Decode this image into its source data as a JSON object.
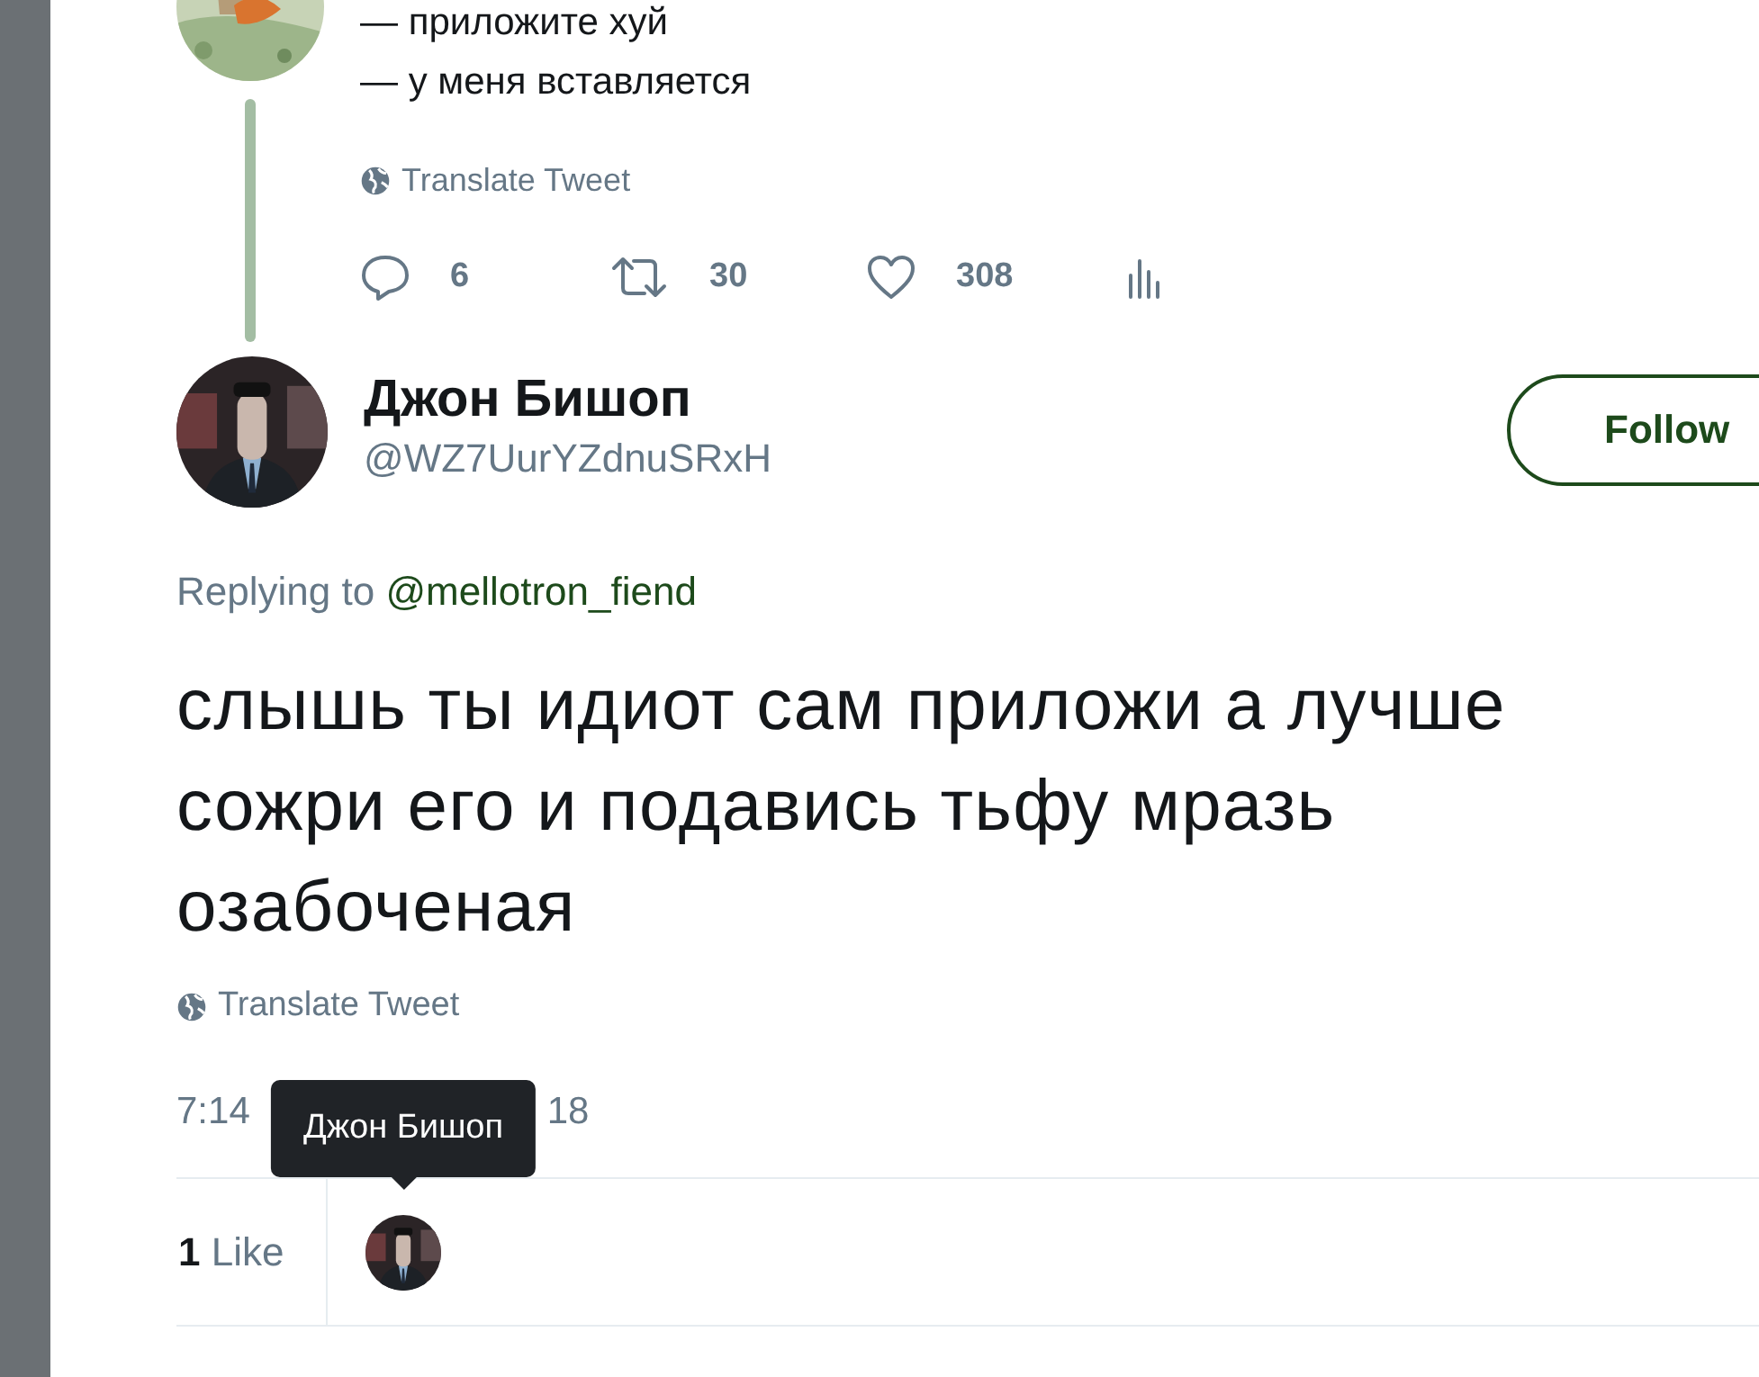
{
  "thread_tweet": {
    "lines": [
      "— приложите хуй",
      "— у меня вставляется"
    ],
    "translate": "Translate Tweet",
    "actions": [
      {
        "kind": "reply",
        "count": "6"
      },
      {
        "kind": "retweet",
        "count": "30"
      },
      {
        "kind": "like",
        "count": "308"
      },
      {
        "kind": "analytics"
      }
    ]
  },
  "tweet": {
    "name": "Джон Бишоп",
    "handle": "@WZ7UurYZdnuSRxH",
    "follow": "Follow",
    "replying_label": "Replying to",
    "replying_to": "@mellotron_fiend",
    "text": "слышь ты идиот сам приложи а лучше сожри его и подавись тьфу мразь озабоченая",
    "translate": "Translate Tweet",
    "timestamp": [
      "7:14",
      "18"
    ],
    "likes": "**1** Like",
    "tooltip": "Джон Бишоп"
  }
}
